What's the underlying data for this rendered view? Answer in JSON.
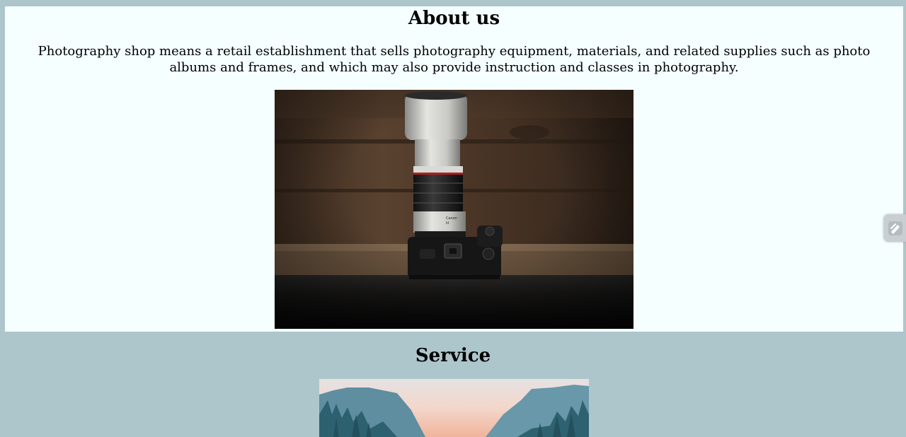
{
  "about": {
    "title": "About us",
    "description": "Photography shop means a retail establishment that sells photography equipment, materials, and related supplies such as photo albums and frames, and which may also provide instruction and classes in photography.",
    "camera_label_brand": "Canon",
    "camera_label_model": "RF"
  },
  "service": {
    "title": "Service"
  },
  "colors": {
    "page_background": "#adc6cc",
    "about_background": "#f5ffff"
  },
  "widget": {
    "icon": "edit-pen-icon"
  }
}
